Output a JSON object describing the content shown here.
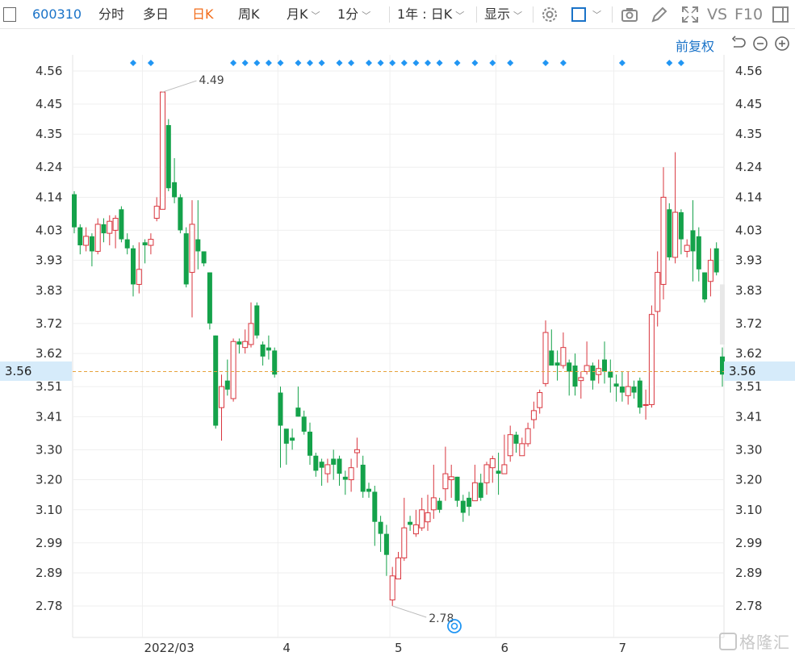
{
  "toolbar": {
    "stock_code": "600310",
    "tabs": [
      "分时",
      "多日",
      "日K",
      "周K",
      "月K",
      "1分"
    ],
    "active_tab": "日K",
    "range_select": "1年 : 日K",
    "display_label": "显示",
    "vs_label": "VS",
    "f10_label": "F10"
  },
  "subbar": {
    "adjust_label": "前复权"
  },
  "colors": {
    "up": "#d9363e",
    "down": "#14a24a",
    "current_line": "#e6a23c",
    "marker": "#2196f3",
    "accent": "#1a73c8"
  },
  "current_price": {
    "label": "3.56",
    "value": 3.56
  },
  "chart_data": {
    "type": "candlestick",
    "yticks": [
      "4.56",
      "4.45",
      "4.35",
      "4.24",
      "4.14",
      "4.03",
      "3.93",
      "3.83",
      "3.72",
      "3.62",
      "3.51",
      "3.41",
      "3.30",
      "3.20",
      "3.10",
      "2.99",
      "2.89",
      "2.78"
    ],
    "ylim": [
      2.73,
      4.6
    ],
    "xlabels": [
      "2022/03",
      "4",
      "5",
      "6",
      "7"
    ],
    "annotations": {
      "max_label": "4.49",
      "min_label": "2.78"
    },
    "candles": [
      [
        4.15,
        4.04,
        4.16,
        4.02
      ],
      [
        4.04,
        3.98,
        4.05,
        3.95
      ],
      [
        3.98,
        4.01,
        4.04,
        3.96
      ],
      [
        4.01,
        3.96,
        4.02,
        3.91
      ],
      [
        3.96,
        4.05,
        4.07,
        3.95
      ],
      [
        4.05,
        4.02,
        4.07,
        3.99
      ],
      [
        4.02,
        4.06,
        4.08,
        3.98
      ],
      [
        4.03,
        4.07,
        4.08,
        3.97
      ],
      [
        4.1,
        4.0,
        4.11,
        3.99
      ],
      [
        4.0,
        3.97,
        4.02,
        3.95
      ],
      [
        3.97,
        3.85,
        3.98,
        3.81
      ],
      [
        3.85,
        3.9,
        3.99,
        3.82
      ],
      [
        3.99,
        3.98,
        4.0,
        3.92
      ],
      [
        3.98,
        4.0,
        4.02,
        3.95
      ],
      [
        4.07,
        4.11,
        4.14,
        4.06
      ],
      [
        4.1,
        4.49,
        4.49,
        4.1
      ],
      [
        4.38,
        4.17,
        4.4,
        4.16
      ],
      [
        4.19,
        4.14,
        4.27,
        4.12
      ],
      [
        4.14,
        4.03,
        4.15,
        4.02
      ],
      [
        4.02,
        3.85,
        4.04,
        3.84
      ],
      [
        3.89,
        4.05,
        4.13,
        3.74
      ],
      [
        4.0,
        3.96,
        4.13,
        3.9
      ],
      [
        3.96,
        3.92,
        3.96,
        3.91
      ],
      [
        3.89,
        3.72,
        3.89,
        3.7
      ],
      [
        3.68,
        3.38,
        3.68,
        3.37
      ],
      [
        3.44,
        3.51,
        3.55,
        3.33
      ],
      [
        3.53,
        3.5,
        3.6,
        3.48
      ],
      [
        3.47,
        3.66,
        3.67,
        3.46
      ],
      [
        3.66,
        3.65,
        3.67,
        3.62
      ],
      [
        3.64,
        3.66,
        3.7,
        3.62
      ],
      [
        3.65,
        3.72,
        3.79,
        3.64
      ],
      [
        3.78,
        3.68,
        3.79,
        3.67
      ],
      [
        3.65,
        3.61,
        3.66,
        3.58
      ],
      [
        3.64,
        3.63,
        3.68,
        3.6
      ],
      [
        3.63,
        3.55,
        3.64,
        3.54
      ],
      [
        3.49,
        3.38,
        3.51,
        3.24
      ],
      [
        3.37,
        3.32,
        3.34,
        3.25
      ],
      [
        3.34,
        3.33,
        3.37,
        3.3
      ],
      [
        3.44,
        3.41,
        3.51,
        3.41
      ],
      [
        3.41,
        3.36,
        3.43,
        3.35
      ],
      [
        3.36,
        3.28,
        3.39,
        3.25
      ],
      [
        3.28,
        3.23,
        3.29,
        3.21
      ],
      [
        3.26,
        3.24,
        3.27,
        3.18
      ],
      [
        3.22,
        3.25,
        3.27,
        3.19
      ],
      [
        3.27,
        3.25,
        3.3,
        3.2
      ],
      [
        3.27,
        3.22,
        3.28,
        3.18
      ],
      [
        3.21,
        3.2,
        3.23,
        3.15
      ],
      [
        3.2,
        3.24,
        3.27,
        3.16
      ],
      [
        3.29,
        3.3,
        3.34,
        3.24
      ],
      [
        3.25,
        3.16,
        3.28,
        3.14
      ],
      [
        3.17,
        3.16,
        3.19,
        3.14
      ],
      [
        3.16,
        3.06,
        3.18,
        2.98
      ],
      [
        3.06,
        3.02,
        3.08,
        2.96
      ],
      [
        3.02,
        2.95,
        3.05,
        2.88
      ],
      [
        2.8,
        2.88,
        2.91,
        2.78
      ],
      [
        2.87,
        2.94,
        2.96,
        2.89
      ],
      [
        2.94,
        3.04,
        3.14,
        2.93
      ],
      [
        3.06,
        3.05,
        3.08,
        3.03
      ],
      [
        3.02,
        3.05,
        3.1,
        3.01
      ],
      [
        3.04,
        3.1,
        3.14,
        3.03
      ],
      [
        3.06,
        3.09,
        3.15,
        3.03
      ],
      [
        3.1,
        3.14,
        3.25,
        3.07
      ],
      [
        3.13,
        3.1,
        3.14,
        3.09
      ],
      [
        3.17,
        3.22,
        3.31,
        3.13
      ],
      [
        3.2,
        3.21,
        3.25,
        3.14
      ],
      [
        3.21,
        3.13,
        3.21,
        3.11
      ],
      [
        3.13,
        3.09,
        3.15,
        3.06
      ],
      [
        3.14,
        3.11,
        3.16,
        3.08
      ],
      [
        3.13,
        3.19,
        3.25,
        3.15
      ],
      [
        3.19,
        3.14,
        3.22,
        3.13
      ],
      [
        3.19,
        3.25,
        3.26,
        3.15
      ],
      [
        3.24,
        3.27,
        3.28,
        3.19
      ],
      [
        3.23,
        3.22,
        3.29,
        3.15
      ],
      [
        3.22,
        3.25,
        3.35,
        3.24
      ],
      [
        3.28,
        3.35,
        3.38,
        3.26
      ],
      [
        3.35,
        3.32,
        3.36,
        3.29
      ],
      [
        3.28,
        3.32,
        3.34,
        3.28
      ],
      [
        3.32,
        3.37,
        3.39,
        3.31
      ],
      [
        3.4,
        3.43,
        3.46,
        3.37
      ],
      [
        3.44,
        3.49,
        3.5,
        3.42
      ],
      [
        3.52,
        3.69,
        3.73,
        3.51
      ],
      [
        3.63,
        3.58,
        3.7,
        3.58
      ],
      [
        3.59,
        3.58,
        3.63,
        3.53
      ],
      [
        3.58,
        3.64,
        3.69,
        3.57
      ],
      [
        3.59,
        3.56,
        3.6,
        3.48
      ],
      [
        3.58,
        3.51,
        3.62,
        3.48
      ],
      [
        3.53,
        3.54,
        3.56,
        3.47
      ],
      [
        3.56,
        3.58,
        3.66,
        3.55
      ],
      [
        3.58,
        3.53,
        3.59,
        3.5
      ],
      [
        3.55,
        3.57,
        3.6,
        3.52
      ],
      [
        3.6,
        3.56,
        3.66,
        3.52
      ],
      [
        3.56,
        3.54,
        3.6,
        3.49
      ],
      [
        3.52,
        3.51,
        3.55,
        3.46
      ],
      [
        3.51,
        3.49,
        3.56,
        3.46
      ],
      [
        3.48,
        3.51,
        3.56,
        3.45
      ],
      [
        3.51,
        3.49,
        3.53,
        3.47
      ],
      [
        3.53,
        3.44,
        3.54,
        3.42
      ],
      [
        3.45,
        3.45,
        3.5,
        3.4
      ],
      [
        3.45,
        3.75,
        3.78,
        3.44
      ],
      [
        3.76,
        3.89,
        3.96,
        3.71
      ],
      [
        3.85,
        4.14,
        4.24,
        3.8
      ],
      [
        4.1,
        3.94,
        4.12,
        3.93
      ],
      [
        3.94,
        4.09,
        4.29,
        3.92
      ],
      [
        4.09,
        4.0,
        4.1,
        3.95
      ],
      [
        3.96,
        3.98,
        4.0,
        3.94
      ],
      [
        4.03,
        3.96,
        4.13,
        3.86
      ],
      [
        4.01,
        3.9,
        4.04,
        3.86
      ],
      [
        3.89,
        3.8,
        3.89,
        3.79
      ],
      [
        3.86,
        3.93,
        3.97,
        3.81
      ],
      [
        3.97,
        3.89,
        3.99,
        3.88
      ],
      [
        3.61,
        3.55,
        3.64,
        3.51
      ]
    ],
    "markers": [
      10,
      13,
      27,
      29,
      31,
      33,
      35,
      38,
      40,
      42,
      45,
      47,
      50,
      52,
      54,
      56,
      58,
      60,
      62,
      65,
      68,
      71,
      74,
      80,
      83,
      93,
      101,
      103
    ]
  }
}
